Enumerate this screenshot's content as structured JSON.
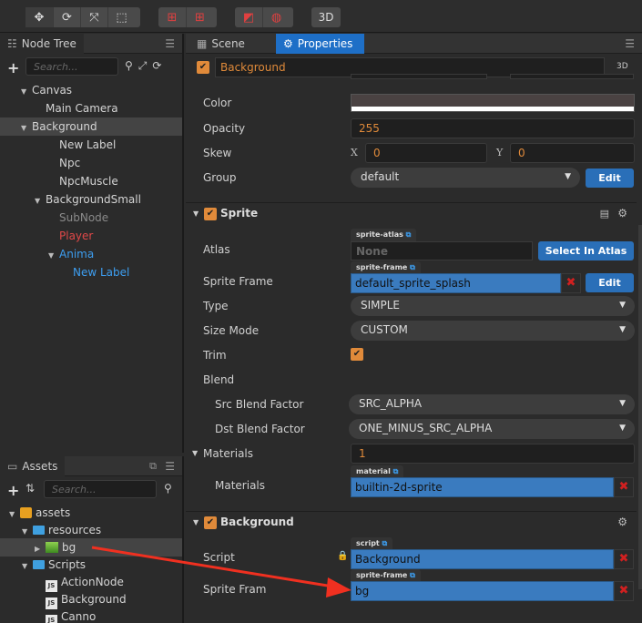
{
  "toolbar": {
    "mode_3d": "3D"
  },
  "node_tree": {
    "tab": "Node Tree",
    "search_placeholder": "Search...",
    "items": [
      {
        "label": "Canvas",
        "depth": 1,
        "caret": "▼"
      },
      {
        "label": "Main Camera",
        "depth": 2,
        "caret": ""
      },
      {
        "label": "Background",
        "depth": 1,
        "caret": "▼",
        "selected": true
      },
      {
        "label": "New Label",
        "depth": 3,
        "caret": ""
      },
      {
        "label": "Npc",
        "depth": 3,
        "caret": ""
      },
      {
        "label": "NpcMuscle",
        "depth": 3,
        "caret": ""
      },
      {
        "label": "BackgroundSmall",
        "depth": 2,
        "caret": "▼"
      },
      {
        "label": "SubNode",
        "depth": 3,
        "caret": "",
        "color": "#8a8a8a"
      },
      {
        "label": "Player",
        "depth": 3,
        "caret": "",
        "color": "#e04848"
      },
      {
        "label": "Anima",
        "depth": 3,
        "caret": "▼",
        "color": "#3d9ef0"
      },
      {
        "label": "New Label",
        "depth": 4,
        "caret": "",
        "color": "#3d9ef0"
      }
    ]
  },
  "assets": {
    "tab": "Assets",
    "search_placeholder": "Search...",
    "items": [
      {
        "label": "assets",
        "icon": "package-icon"
      },
      {
        "label": "resources",
        "icon": "folder-icon"
      },
      {
        "label": "bg",
        "icon": "image-icon",
        "selected": true
      },
      {
        "label": "Scripts",
        "icon": "folder-icon"
      },
      {
        "label": "ActionNode",
        "icon": "js-icon"
      },
      {
        "label": "Background",
        "icon": "js-icon"
      },
      {
        "label": "Canno",
        "icon": "js-icon"
      }
    ],
    "js_badge": "JS"
  },
  "properties": {
    "tab_scene": "Scene",
    "tab_properties": "Properties",
    "node_name": "Background",
    "btn_3d": "3D",
    "color_label": "Color",
    "color_value": "#ffffff",
    "opacity_label": "Opacity",
    "opacity_value": "255",
    "skew_label": "Skew",
    "skew_x_label": "X",
    "skew_x_value": "0",
    "skew_y_label": "Y",
    "skew_y_value": "0",
    "group_label": "Group",
    "group_value": "default",
    "edit_label": "Edit",
    "sprite": {
      "title": "Sprite",
      "atlas_label": "Atlas",
      "atlas_tag": "sprite-atlas",
      "atlas_value": "None",
      "select_atlas": "Select In Atlas",
      "frame_label": "Sprite Frame",
      "frame_tag": "sprite-frame",
      "frame_value": "default_sprite_splash",
      "type_label": "Type",
      "type_value": "SIMPLE",
      "size_mode_label": "Size Mode",
      "size_mode_value": "CUSTOM",
      "trim_label": "Trim",
      "blend_label": "Blend",
      "src_label": "Src Blend Factor",
      "src_value": "SRC_ALPHA",
      "dst_label": "Dst Blend Factor",
      "dst_value": "ONE_MINUS_SRC_ALPHA",
      "materials_label": "Materials",
      "materials_count": "1",
      "material_item_label": "Materials",
      "material_tag": "material",
      "material_value": "builtin-2d-sprite"
    },
    "background_comp": {
      "title": "Background",
      "script_label": "Script",
      "script_tag": "script",
      "script_value": "Background",
      "frame_label": "Sprite Fram",
      "frame_tag": "sprite-frame",
      "frame_value": "bg"
    }
  },
  "colors": {
    "accent": "#e08a3a",
    "selected_tab": "#1e6fc7",
    "arrow": "#f03020"
  }
}
